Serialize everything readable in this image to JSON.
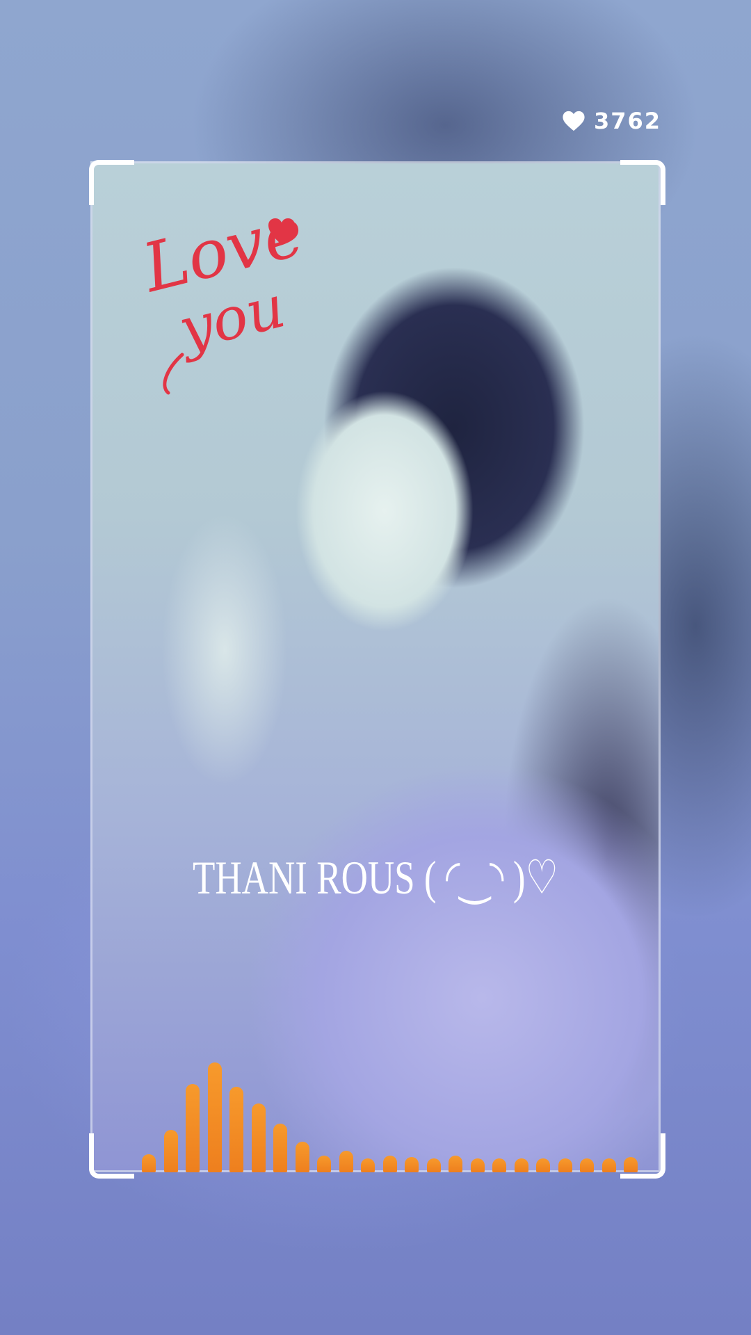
{
  "likes": {
    "icon": "heart-icon",
    "count": "3762"
  },
  "sticker": {
    "text_line1": "Love",
    "text_line2": "you",
    "color": "#e23545"
  },
  "caption": {
    "text": "THANI ROUS ( ◜‿◝ )♡"
  },
  "visualizer": {
    "color": "#f28a24",
    "levels": [
      0.12,
      0.28,
      0.58,
      0.72,
      0.56,
      0.45,
      0.32,
      0.2,
      0.11,
      0.14,
      0.09,
      0.11,
      0.1,
      0.09,
      0.11,
      0.09,
      0.09,
      0.09,
      0.09,
      0.08,
      0.08,
      0.09,
      0.1
    ]
  },
  "colors": {
    "frame_corner": "#ffffff",
    "text": "#ffffff"
  }
}
